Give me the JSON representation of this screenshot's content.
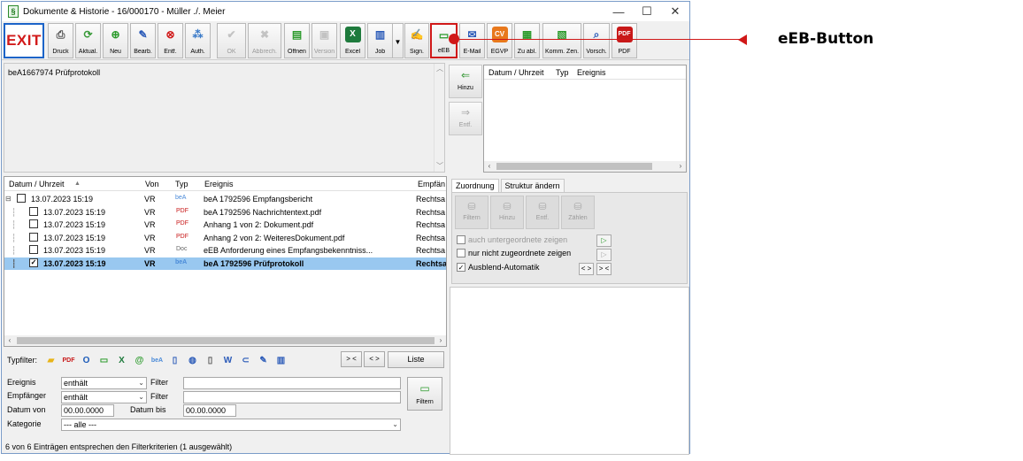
{
  "window": {
    "title": "Dokumente & Historie - 16/000170 - Müller ./. Meier",
    "minimize": "—",
    "maximize": "☐",
    "close": "✕"
  },
  "toolbar": {
    "exit": "EXIT",
    "buttons": [
      {
        "label": "Druck",
        "icon": "print-icon"
      },
      {
        "label": "Aktual.",
        "icon": "refresh-icon"
      },
      {
        "label": "Neu",
        "icon": "new-icon"
      },
      {
        "label": "Bearb.",
        "icon": "edit-icon"
      },
      {
        "label": "Entf.",
        "icon": "delete-icon"
      },
      {
        "label": "Auth.",
        "icon": "auth-icon"
      },
      {
        "label": "OK",
        "icon": "check-icon"
      },
      {
        "label": "Abbrech.",
        "icon": "cancel-icon"
      },
      {
        "label": "Öffnen",
        "icon": "open-icon"
      },
      {
        "label": "Version",
        "icon": "version-icon"
      },
      {
        "label": "Excel",
        "icon": "excel-icon"
      },
      {
        "label": "Job",
        "icon": "job-icon"
      },
      {
        "label": "Sign.",
        "icon": "sign-icon"
      },
      {
        "label": "eEB",
        "icon": "eeb-icon"
      },
      {
        "label": "E-Mail",
        "icon": "email-icon"
      },
      {
        "label": "EGVP",
        "icon": "egvp-icon"
      },
      {
        "label": "Zu abl.",
        "icon": "file-icon"
      },
      {
        "label": "Komm. Zen.",
        "icon": "comm-icon"
      },
      {
        "label": "Vorsch.",
        "icon": "preview-icon"
      },
      {
        "label": "PDF",
        "icon": "pdf-icon"
      }
    ]
  },
  "preview": {
    "text": "beA1667974 Prüfprotokoll"
  },
  "side_buttons": {
    "add": "Hinzu",
    "remove": "Entf."
  },
  "small_grid": {
    "columns": [
      "Datum / Uhrzeit",
      "Typ",
      "Ereignis"
    ]
  },
  "main_grid": {
    "columns": [
      "Datum / Uhrzeit",
      "Von",
      "Typ",
      "Ereignis",
      "Empfän"
    ],
    "rows": [
      {
        "date": "13.07.2023  15:19",
        "from": "VR",
        "type": "beA",
        "event": "beA 1792596 Empfangsbericht",
        "recipient": "Rechtsa"
      },
      {
        "date": "13.07.2023  15:19",
        "from": "VR",
        "type": "PDF",
        "event": "beA 1792596 Nachrichtentext.pdf",
        "recipient": "Rechtsa"
      },
      {
        "date": "13.07.2023  15:19",
        "from": "VR",
        "type": "PDF",
        "event": "Anhang 1 von 2: Dokument.pdf",
        "recipient": "Rechtsa"
      },
      {
        "date": "13.07.2023  15:19",
        "from": "VR",
        "type": "PDF",
        "event": "Anhang 2 von 2: WeiteresDokument.pdf",
        "recipient": "Rechtsa"
      },
      {
        "date": "13.07.2023  15:19",
        "from": "VR",
        "type": "Doc",
        "event": "eEB Anforderung eines Empfangsbekenntniss...",
        "recipient": "Rechtsa"
      },
      {
        "date": "13.07.2023  15:19",
        "from": "VR",
        "type": "beA",
        "event": "beA 1792596 Prüfprotokoll",
        "recipient": "Rechtsa"
      }
    ]
  },
  "tabs": {
    "assignment": "Zuordnung",
    "structure": "Struktur ändern"
  },
  "assignment_buttons": [
    "Filtern",
    "Hinzu",
    "Entf.",
    "Zählen"
  ],
  "options": {
    "subordinate": "auch untergeordnete zeigen",
    "unassigned": "nur nicht zugeordnete zeigen",
    "auto_hide": "Ausblend-Automatik",
    "nav_prev": "< >",
    "nav_next": "> <"
  },
  "type_filter": {
    "label": "Typfilter:",
    "btn1": "> <",
    "btn2": "< >",
    "list": "Liste"
  },
  "filters": {
    "event_label": "Ereignis",
    "recipient_label": "Empfänger",
    "date_from_label": "Datum von",
    "date_to_label": "Datum bis",
    "category_label": "Kategorie",
    "contains1": "enthält",
    "contains2": "enthält",
    "filter1": "Filter",
    "filter2": "Filter",
    "date_from": "00.00.0000",
    "date_to": "00.00.0000",
    "category": "--- alle ---",
    "button": "Filtern"
  },
  "status": "6 von 6 Einträgen entsprechen den Filterkriterien (1 ausgewählt)",
  "annotation": "eEB-Button"
}
